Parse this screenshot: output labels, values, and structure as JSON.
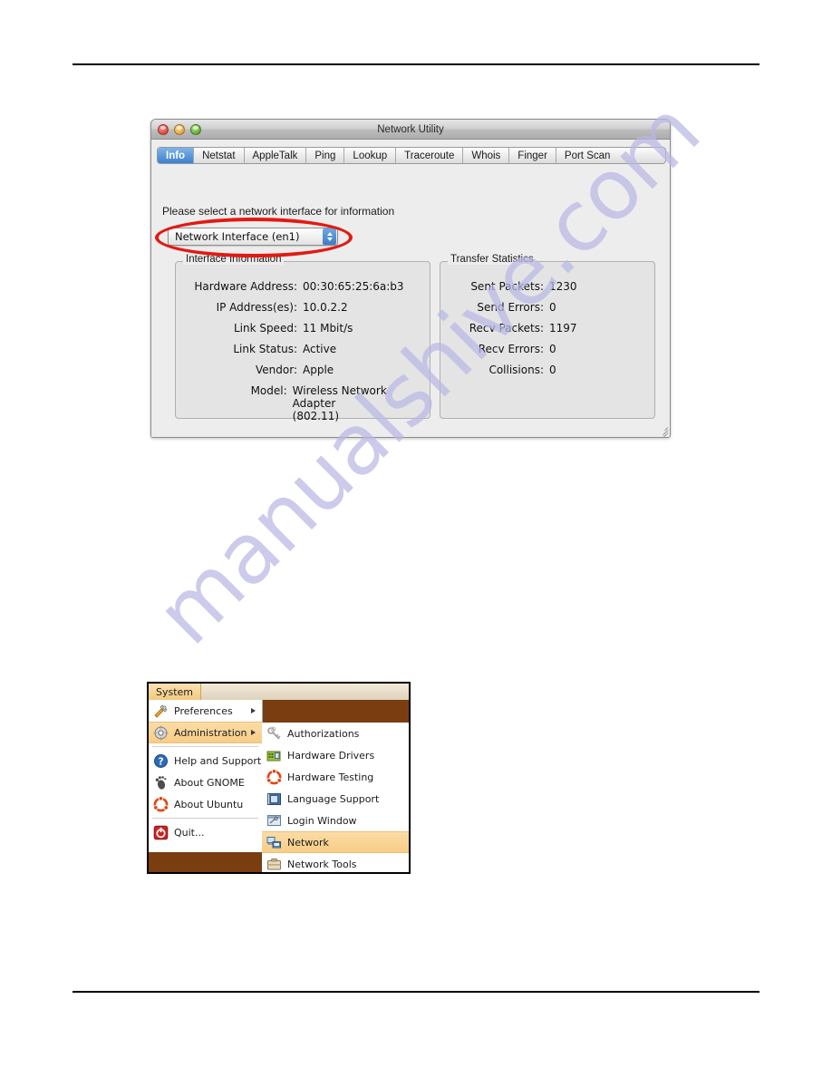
{
  "page": {
    "has_top_rule": true,
    "has_bottom_rule": true
  },
  "watermark": {
    "text": "manualshive.com",
    "color": "#b9b8e4"
  },
  "mac_window": {
    "title": "Network Utility",
    "traffic_lights": {
      "close": "close-button",
      "minimize": "minimize-button",
      "zoom": "zoom-button"
    },
    "tabs": [
      {
        "label": "Info",
        "active": true
      },
      {
        "label": "Netstat",
        "active": false
      },
      {
        "label": "AppleTalk",
        "active": false
      },
      {
        "label": "Ping",
        "active": false
      },
      {
        "label": "Lookup",
        "active": false
      },
      {
        "label": "Traceroute",
        "active": false
      },
      {
        "label": "Whois",
        "active": false
      },
      {
        "label": "Finger",
        "active": false
      },
      {
        "label": "Port Scan",
        "active": false
      }
    ],
    "prompt": "Please select a network interface for information",
    "interface_select": {
      "value": "Network Interface (en1)",
      "annotated": true,
      "annotation_color": "#e21a12"
    },
    "interface_information": {
      "title": "Interface Information",
      "fields": [
        {
          "label": "Hardware Address:",
          "value": "00:30:65:25:6a:b3"
        },
        {
          "label": "IP Address(es):",
          "value": "10.0.2.2"
        },
        {
          "label": "Link Speed:",
          "value": "11 Mbit/s"
        },
        {
          "label": "Link Status:",
          "value": "Active"
        },
        {
          "label": "Vendor:",
          "value": "Apple"
        },
        {
          "label": "Model:",
          "value": "Wireless Network Adapter\n(802.11)"
        }
      ]
    },
    "transfer_statistics": {
      "title": "Transfer Statistics",
      "fields": [
        {
          "label": "Sent Packets:",
          "value": "1230"
        },
        {
          "label": "Send Errors:",
          "value": "0"
        },
        {
          "label": "Recv Packets:",
          "value": "1197"
        },
        {
          "label": "Recv Errors:",
          "value": "0"
        },
        {
          "label": "Collisions:",
          "value": "0"
        }
      ]
    }
  },
  "gnome_menu": {
    "panel_item": "System",
    "primary_items": [
      {
        "label": "Preferences",
        "icon": "preferences-icon",
        "has_submenu": true,
        "highlighted": false
      },
      {
        "label": "Administration",
        "icon": "administration-gear-icon",
        "has_submenu": true,
        "highlighted": true
      },
      {
        "label": "Help and Support",
        "icon": "help-question-icon",
        "has_submenu": false,
        "highlighted": false
      },
      {
        "label": "About GNOME",
        "icon": "gnome-foot-icon",
        "has_submenu": false,
        "highlighted": false
      },
      {
        "label": "About Ubuntu",
        "icon": "ubuntu-logo-icon",
        "has_submenu": false,
        "highlighted": false
      },
      {
        "label": "Quit...",
        "icon": "power-quit-icon",
        "has_submenu": false,
        "highlighted": false
      }
    ],
    "submenu_items": [
      {
        "label": "Authorizations",
        "icon": "keys-icon",
        "highlighted": false
      },
      {
        "label": "Hardware Drivers",
        "icon": "hardware-drivers-icon",
        "highlighted": false
      },
      {
        "label": "Hardware Testing",
        "icon": "ubuntu-logo-icon",
        "highlighted": false
      },
      {
        "label": "Language Support",
        "icon": "language-flag-icon",
        "highlighted": false
      },
      {
        "label": "Login Window",
        "icon": "login-window-icon",
        "highlighted": false
      },
      {
        "label": "Network",
        "icon": "network-computers-icon",
        "highlighted": true
      },
      {
        "label": "Network Tools",
        "icon": "network-tools-icon",
        "highlighted": false
      }
    ]
  }
}
